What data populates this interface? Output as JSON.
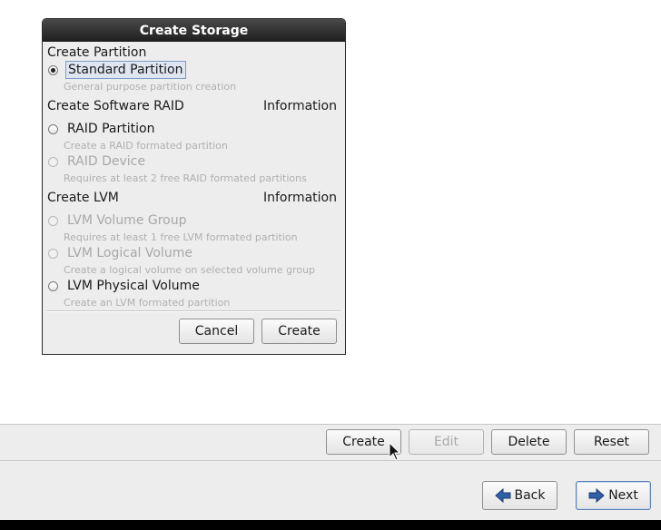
{
  "dialog": {
    "title": "Create Storage",
    "partition_section": "Create Partition",
    "standard_partition": "Standard Partition",
    "standard_partition_desc": "General purpose partition creation",
    "raid_section": "Create Software RAID",
    "raid_info": "Information",
    "raid_partition": "RAID Partition",
    "raid_partition_desc": "Create a RAID formated partition",
    "raid_device": "RAID Device",
    "raid_device_desc": "Requires at least 2 free RAID formated partitions",
    "lvm_section": "Create LVM",
    "lvm_info": "Information",
    "lvm_volume_group": "LVM Volume Group",
    "lvm_volume_group_desc": "Requires at least 1 free LVM formated partition",
    "lvm_logical_volume": "LVM Logical Volume",
    "lvm_logical_volume_desc": "Create a logical volume on selected volume group",
    "lvm_physical_volume": "LVM Physical Volume",
    "lvm_physical_volume_desc": "Create an LVM formated partition",
    "cancel": "Cancel",
    "create": "Create"
  },
  "toolbar": {
    "create": "Create",
    "edit": "Edit",
    "delete": "Delete",
    "reset": "Reset"
  },
  "nav": {
    "back": "Back",
    "next": "Next"
  },
  "icons": {
    "back": "left-arrow-icon",
    "next": "right-arrow-icon",
    "cursor": "mouse-pointer-icon"
  },
  "colors": {
    "arrow_blue": "#2f5fa8"
  }
}
